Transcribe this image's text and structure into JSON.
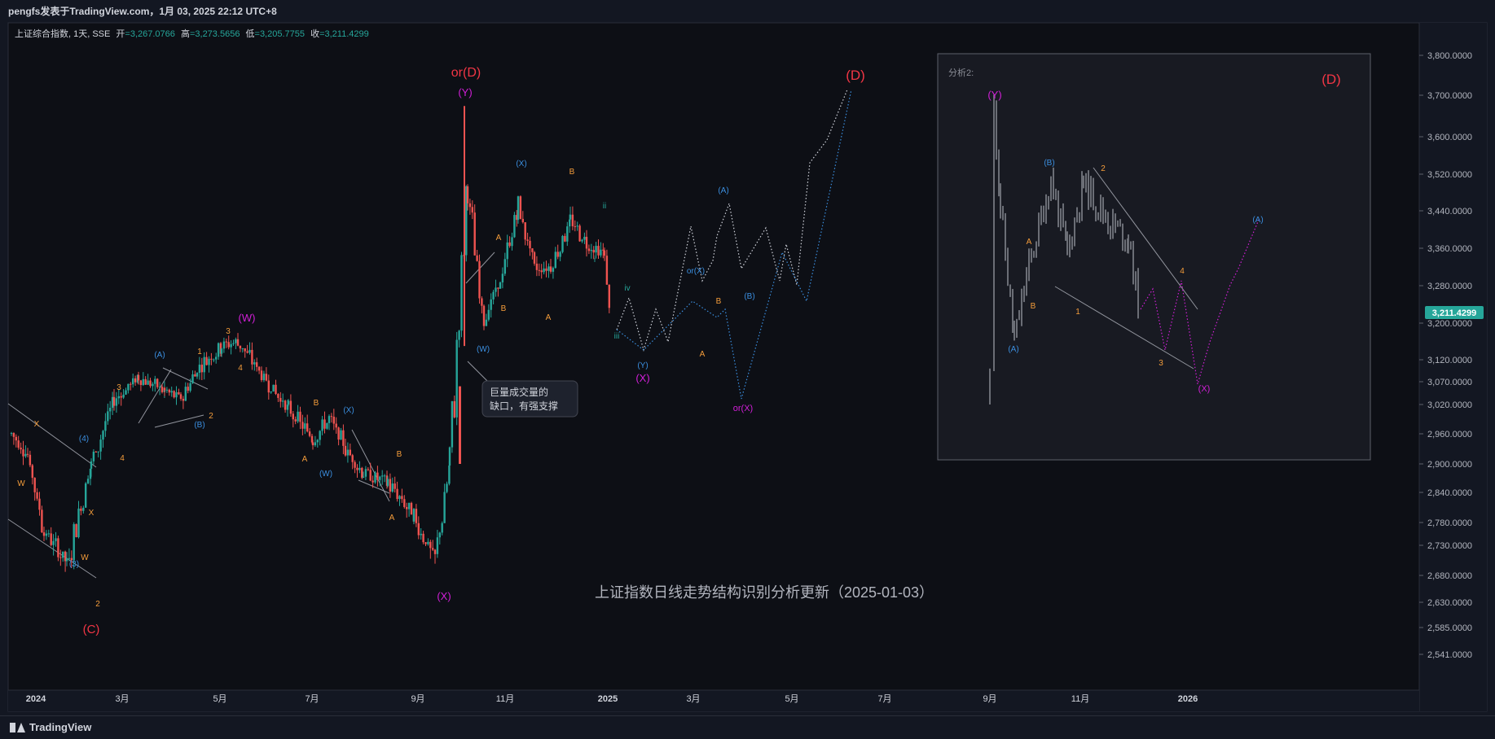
{
  "header": {
    "publisher": "pengfs发表于TradingView.com，1月 03, 2025 22:12 UTC+8"
  },
  "symbol_info": {
    "name": "上证综合指数, 1天, SSE",
    "open_label": "开",
    "open": "=3,267.0766",
    "high_label": "高",
    "high": "=3,273.5656",
    "low_label": "低",
    "low": "=3,205.7755",
    "close_label": "收",
    "close": "=3,211.4299"
  },
  "watermark_title": "上证指数日线走势结构识别分析更新（2025-01-03）",
  "callout": {
    "line1": "巨量成交量的",
    "line2": "缺口，有强支撑"
  },
  "inset": {
    "title": "分析2:"
  },
  "last_price_tag": "3,211.4299",
  "brand": "TradingView",
  "colors": {
    "background": "#131722",
    "up": "#26a69a",
    "down": "#ef5350",
    "blue_label": "#3b8fe0",
    "orange_label": "#f39c3a",
    "magenta_label": "#d21fd8",
    "red_label": "#f23645",
    "inset_candles": "#6b6e76"
  },
  "chart_data": {
    "type": "candlestick",
    "instrument": "上证综合指数",
    "y_axis_ticks": [
      "3,800.0000",
      "3,700.0000",
      "3,600.0000",
      "3,520.0000",
      "3,440.0000",
      "3,360.0000",
      "3,280.0000",
      "3,200.0000",
      "3,120.0000",
      "3,070.0000",
      "3,020.0000",
      "2,960.0000",
      "2,900.0000",
      "2,840.0000",
      "2,780.0000",
      "2,730.0000",
      "2,680.0000",
      "2,630.0000",
      "2,585.0000",
      "2,541.0000"
    ],
    "x_axis_ticks": [
      "2024",
      "3月",
      "5月",
      "7月",
      "9月",
      "11月",
      "2025",
      "3月",
      "5月",
      "7月",
      "9月",
      "11月",
      "2026"
    ],
    "last_close": 3211.4299,
    "series": [
      {
        "date": "2024-01-02",
        "close": 2960
      },
      {
        "date": "2024-01-12",
        "close": 2920
      },
      {
        "date": "2024-01-22",
        "close": 2760
      },
      {
        "date": "2024-02-05",
        "close": 2700
      },
      {
        "date": "2024-02-20",
        "close": 2900
      },
      {
        "date": "2024-03-05",
        "close": 3030
      },
      {
        "date": "2024-03-20",
        "close": 3080
      },
      {
        "date": "2024-04-05",
        "close": 3050
      },
      {
        "date": "2024-04-15",
        "close": 3030
      },
      {
        "date": "2024-04-25",
        "close": 3100
      },
      {
        "date": "2024-05-10",
        "close": 3150
      },
      {
        "date": "2024-05-20",
        "close": 3160
      },
      {
        "date": "2024-06-05",
        "close": 3080
      },
      {
        "date": "2024-06-20",
        "close": 3010
      },
      {
        "date": "2024-07-05",
        "close": 2950
      },
      {
        "date": "2024-07-15",
        "close": 2990
      },
      {
        "date": "2024-07-25",
        "close": 2930
      },
      {
        "date": "2024-08-05",
        "close": 2880
      },
      {
        "date": "2024-08-20",
        "close": 2860
      },
      {
        "date": "2024-09-05",
        "close": 2790
      },
      {
        "date": "2024-09-18",
        "close": 2700
      },
      {
        "date": "2024-09-27",
        "close": 2900
      },
      {
        "date": "2024-10-08",
        "close": 3480
      },
      {
        "date": "2024-10-18",
        "close": 3210
      },
      {
        "date": "2024-10-28",
        "close": 3290
      },
      {
        "date": "2024-11-08",
        "close": 3450
      },
      {
        "date": "2024-11-18",
        "close": 3320
      },
      {
        "date": "2024-11-28",
        "close": 3320
      },
      {
        "date": "2024-12-10",
        "close": 3420
      },
      {
        "date": "2024-12-20",
        "close": 3370
      },
      {
        "date": "2024-12-31",
        "close": 3350
      },
      {
        "date": "2025-01-03",
        "close": 3211
      }
    ],
    "wave_labels": [
      {
        "text": "(C)",
        "color": "red"
      },
      {
        "text": "or(D)",
        "color": "red"
      },
      {
        "text": "(D)",
        "color": "red"
      },
      {
        "text": "(W)",
        "color": "magenta"
      },
      {
        "text": "(X)",
        "color": "magenta"
      },
      {
        "text": "(Y)",
        "color": "magenta"
      },
      {
        "text": "or(X)",
        "color": "magenta"
      },
      {
        "text": "(A)",
        "color": "blue"
      },
      {
        "text": "(B)",
        "color": "blue"
      },
      {
        "text": "(X)",
        "color": "blue"
      },
      {
        "text": "(W)",
        "color": "blue"
      },
      {
        "text": "(Y)",
        "color": "blue"
      },
      {
        "text": "or(X)",
        "color": "blue"
      },
      {
        "text": "(3)",
        "color": "blue"
      },
      {
        "text": "(4)",
        "color": "blue"
      },
      {
        "text": "A",
        "color": "orange"
      },
      {
        "text": "B",
        "color": "orange"
      },
      {
        "text": "W",
        "color": "orange"
      },
      {
        "text": "X",
        "color": "orange"
      },
      {
        "text": "1",
        "color": "orange"
      },
      {
        "text": "2",
        "color": "orange"
      },
      {
        "text": "3",
        "color": "orange"
      },
      {
        "text": "4",
        "color": "orange"
      },
      {
        "text": "i",
        "color": "teal"
      },
      {
        "text": "ii",
        "color": "teal"
      },
      {
        "text": "iii",
        "color": "teal"
      },
      {
        "text": "iv",
        "color": "teal"
      }
    ]
  }
}
